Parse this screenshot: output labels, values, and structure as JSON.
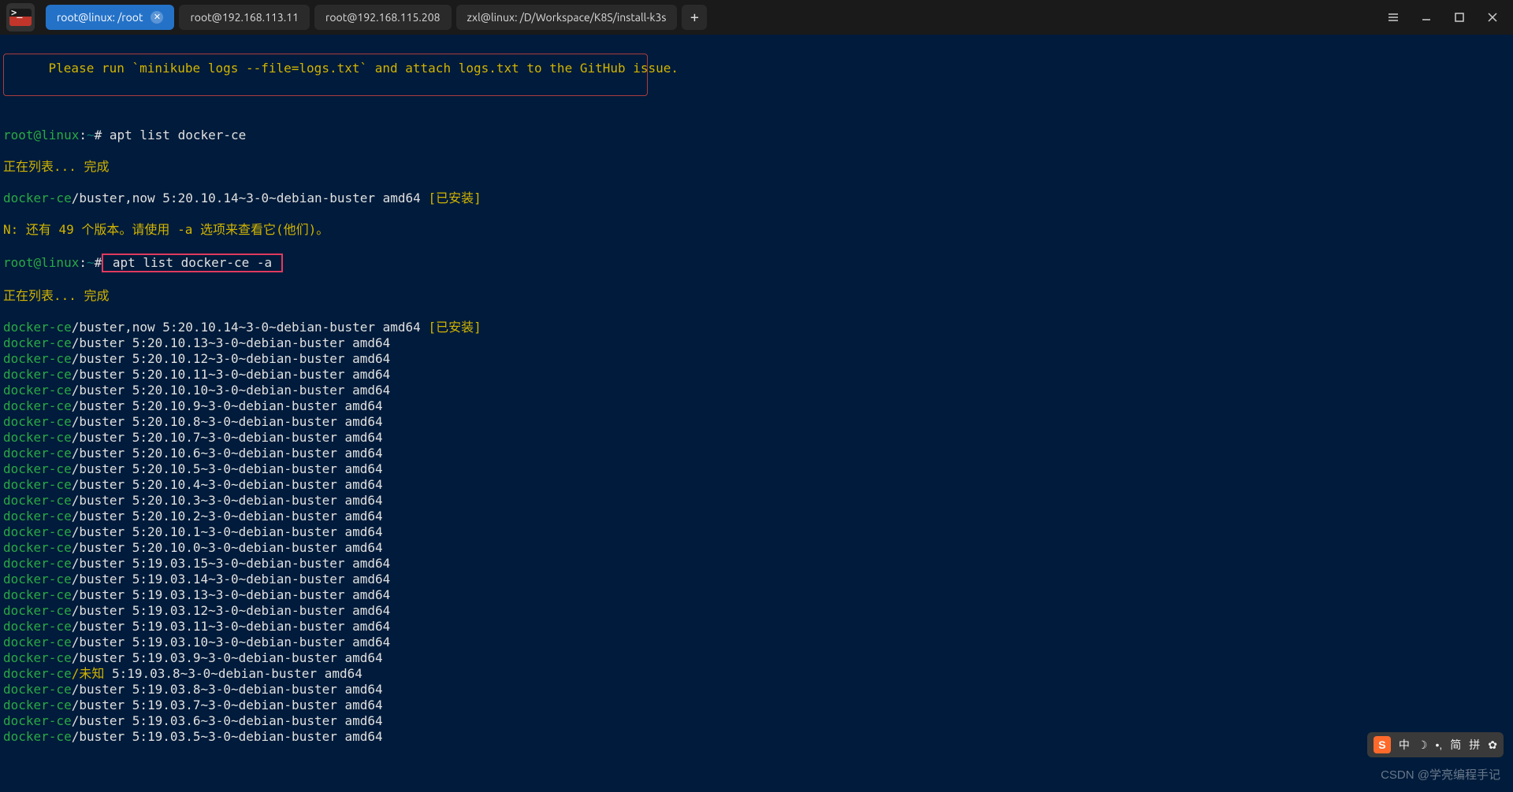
{
  "tabs": [
    {
      "label": "root@linux: /root",
      "active": true,
      "closable": true
    },
    {
      "label": "root@192.168.113.11",
      "active": false,
      "closable": false
    },
    {
      "label": "root@192.168.115.208",
      "active": false,
      "closable": false
    },
    {
      "label": "zxl@linux: /D/Workspace/K8S/install-k3s",
      "active": false,
      "closable": false
    }
  ],
  "new_tab_label": "+",
  "msg_line": "    Please run `minikube logs --file=logs.txt` and attach logs.txt to the GitHub issue.",
  "prompt1_user": "root@linux",
  "prompt1_path": "~",
  "prompt1_cmd": "apt list docker-ce",
  "listing_done": "正在列表... 完成",
  "installed_line_pkg": "docker-ce",
  "installed_line_rest": "/buster,now 5:20.10.14~3-0~debian-buster amd64 ",
  "installed_tag": "[已安装]",
  "note_line": "N: 还有 49 个版本。请使用 -a 选项来查看它(他们)。",
  "prompt2_cmd": " apt list docker-ce -a ",
  "packages": [
    {
      "pkg": "docker-ce",
      "dist": "buster,now",
      "ver": "5:20.10.14~3-0~debian-buster amd64",
      "installed": true
    },
    {
      "pkg": "docker-ce",
      "dist": "buster",
      "ver": "5:20.10.13~3-0~debian-buster amd64"
    },
    {
      "pkg": "docker-ce",
      "dist": "buster",
      "ver": "5:20.10.12~3-0~debian-buster amd64"
    },
    {
      "pkg": "docker-ce",
      "dist": "buster",
      "ver": "5:20.10.11~3-0~debian-buster amd64"
    },
    {
      "pkg": "docker-ce",
      "dist": "buster",
      "ver": "5:20.10.10~3-0~debian-buster amd64"
    },
    {
      "pkg": "docker-ce",
      "dist": "buster",
      "ver": "5:20.10.9~3-0~debian-buster amd64"
    },
    {
      "pkg": "docker-ce",
      "dist": "buster",
      "ver": "5:20.10.8~3-0~debian-buster amd64"
    },
    {
      "pkg": "docker-ce",
      "dist": "buster",
      "ver": "5:20.10.7~3-0~debian-buster amd64"
    },
    {
      "pkg": "docker-ce",
      "dist": "buster",
      "ver": "5:20.10.6~3-0~debian-buster amd64"
    },
    {
      "pkg": "docker-ce",
      "dist": "buster",
      "ver": "5:20.10.5~3-0~debian-buster amd64"
    },
    {
      "pkg": "docker-ce",
      "dist": "buster",
      "ver": "5:20.10.4~3-0~debian-buster amd64"
    },
    {
      "pkg": "docker-ce",
      "dist": "buster",
      "ver": "5:20.10.3~3-0~debian-buster amd64"
    },
    {
      "pkg": "docker-ce",
      "dist": "buster",
      "ver": "5:20.10.2~3-0~debian-buster amd64"
    },
    {
      "pkg": "docker-ce",
      "dist": "buster",
      "ver": "5:20.10.1~3-0~debian-buster amd64"
    },
    {
      "pkg": "docker-ce",
      "dist": "buster",
      "ver": "5:20.10.0~3-0~debian-buster amd64"
    },
    {
      "pkg": "docker-ce",
      "dist": "buster",
      "ver": "5:19.03.15~3-0~debian-buster amd64"
    },
    {
      "pkg": "docker-ce",
      "dist": "buster",
      "ver": "5:19.03.14~3-0~debian-buster amd64"
    },
    {
      "pkg": "docker-ce",
      "dist": "buster",
      "ver": "5:19.03.13~3-0~debian-buster amd64"
    },
    {
      "pkg": "docker-ce",
      "dist": "buster",
      "ver": "5:19.03.12~3-0~debian-buster amd64"
    },
    {
      "pkg": "docker-ce",
      "dist": "buster",
      "ver": "5:19.03.11~3-0~debian-buster amd64"
    },
    {
      "pkg": "docker-ce",
      "dist": "buster",
      "ver": "5:19.03.10~3-0~debian-buster amd64"
    },
    {
      "pkg": "docker-ce",
      "dist": "buster",
      "ver": "5:19.03.9~3-0~debian-buster amd64"
    },
    {
      "pkg": "docker-ce",
      "dist": "未知",
      "ver": "5:19.03.8~3-0~debian-buster amd64",
      "unknown": true
    },
    {
      "pkg": "docker-ce",
      "dist": "buster",
      "ver": "5:19.03.8~3-0~debian-buster amd64"
    },
    {
      "pkg": "docker-ce",
      "dist": "buster",
      "ver": "5:19.03.7~3-0~debian-buster amd64"
    },
    {
      "pkg": "docker-ce",
      "dist": "buster",
      "ver": "5:19.03.6~3-0~debian-buster amd64"
    },
    {
      "pkg": "docker-ce",
      "dist": "buster",
      "ver": "5:19.03.5~3-0~debian-buster amd64"
    }
  ],
  "ime": {
    "logo": "S",
    "mode": "中",
    "moon": "☽",
    "punct": "•,",
    "name": "简",
    "pin": "拼",
    "gear": "✿"
  },
  "watermark": "CSDN @学亮编程手记"
}
